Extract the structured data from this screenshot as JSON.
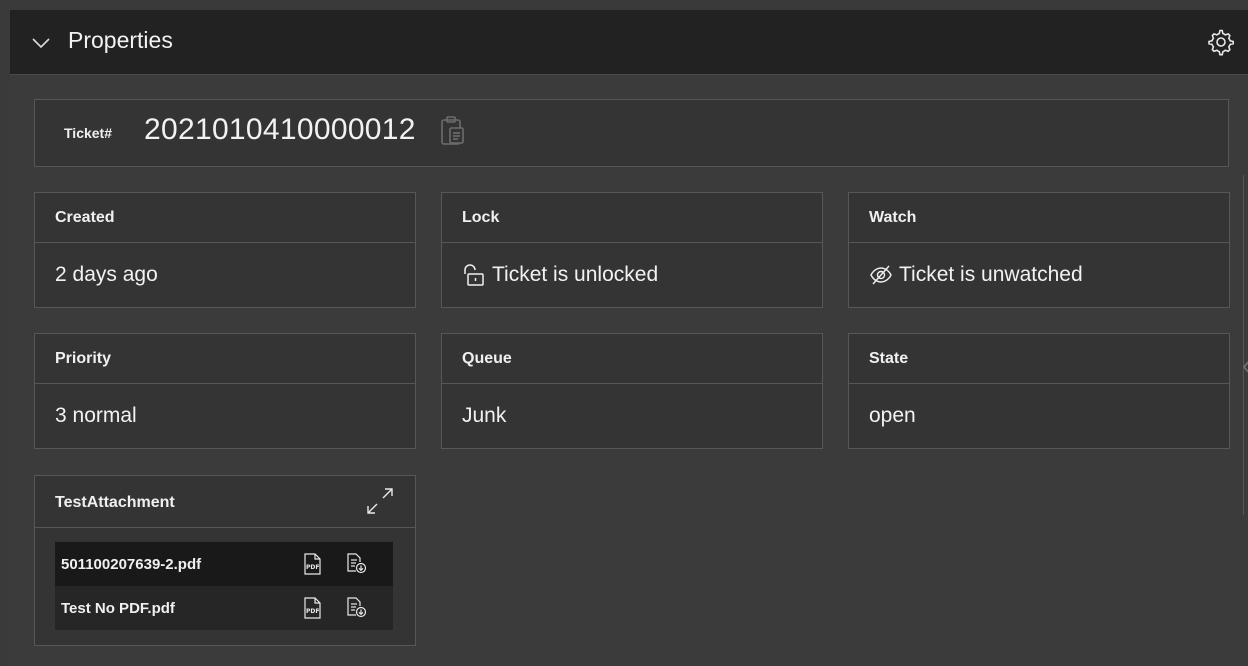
{
  "header": {
    "title": "Properties",
    "collapse_icon": "chevron-down-icon",
    "settings_icon": "gear-icon"
  },
  "ticket": {
    "label": "Ticket#",
    "number": "2021010410000012",
    "copy_icon": "clipboard-icon"
  },
  "fields": [
    {
      "label": "Created",
      "value": "2 days ago"
    },
    {
      "label": "Lock",
      "value": "Ticket is unlocked",
      "icon": "unlocked-padlock-icon"
    },
    {
      "label": "Watch",
      "value": "Ticket is unwatched",
      "icon": "eye-slash-icon"
    },
    {
      "label": "Priority",
      "value": "3 normal"
    },
    {
      "label": "Queue",
      "value": "Junk"
    },
    {
      "label": "State",
      "value": "open"
    }
  ],
  "attachment": {
    "label": "TestAttachment",
    "expand_icon": "expand-icon",
    "files": [
      {
        "name": "501100207639-2.pdf",
        "view_icon": "pdf-icon",
        "download_icon": "download-file-icon"
      },
      {
        "name": "Test No PDF.pdf",
        "view_icon": "pdf-icon",
        "download_icon": "download-file-icon"
      }
    ]
  },
  "colors": {
    "header_bg": "#222222",
    "panel_bg": "#3b3b3b",
    "card_bg": "#343434",
    "border": "#575757",
    "text": "#f0f0f0"
  }
}
